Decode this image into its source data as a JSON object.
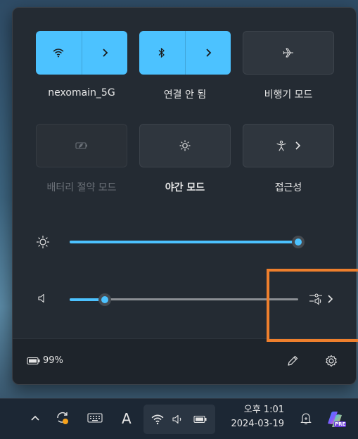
{
  "quick_settings": {
    "tiles": [
      {
        "label": "nexomain_5G",
        "icon": "wifi-icon",
        "state": "on",
        "has_arrow": true
      },
      {
        "label": "연결 안 됨",
        "icon": "bluetooth-icon",
        "state": "on",
        "has_arrow": true
      },
      {
        "label": "비행기 모드",
        "icon": "airplane-icon",
        "state": "off",
        "has_arrow": false
      },
      {
        "label": "배터리 절약 모드",
        "icon": "battery-saver-icon",
        "state": "disabled",
        "has_arrow": false
      },
      {
        "label": "야간 모드",
        "icon": "night-light-icon",
        "state": "off",
        "has_arrow": false
      },
      {
        "label": "접근성",
        "icon": "accessibility-icon",
        "state": "off",
        "has_arrow": true
      }
    ],
    "brightness": {
      "icon": "brightness-icon",
      "value_percent": 100
    },
    "volume": {
      "icon": "speaker-icon",
      "value_percent": 13,
      "device_icon": "sound-output-icon"
    },
    "footer": {
      "battery_text": "99%",
      "battery_icon": "battery-icon",
      "edit_icon": "pencil-icon",
      "settings_icon": "gear-icon"
    }
  },
  "taskbar": {
    "time": "오후 1:01",
    "date": "2024-03-19",
    "ime_label": "A",
    "icons": [
      "chevron-up-icon",
      "sync-icon",
      "keyboard-icon",
      "wifi-icon",
      "speaker-icon",
      "battery-icon",
      "notification-icon",
      "copilot-icon"
    ],
    "copilot_badge": "PRE"
  },
  "colors": {
    "accent": "#4cc2ff",
    "highlight": "#ee7f2d",
    "panel": "#242b33"
  }
}
